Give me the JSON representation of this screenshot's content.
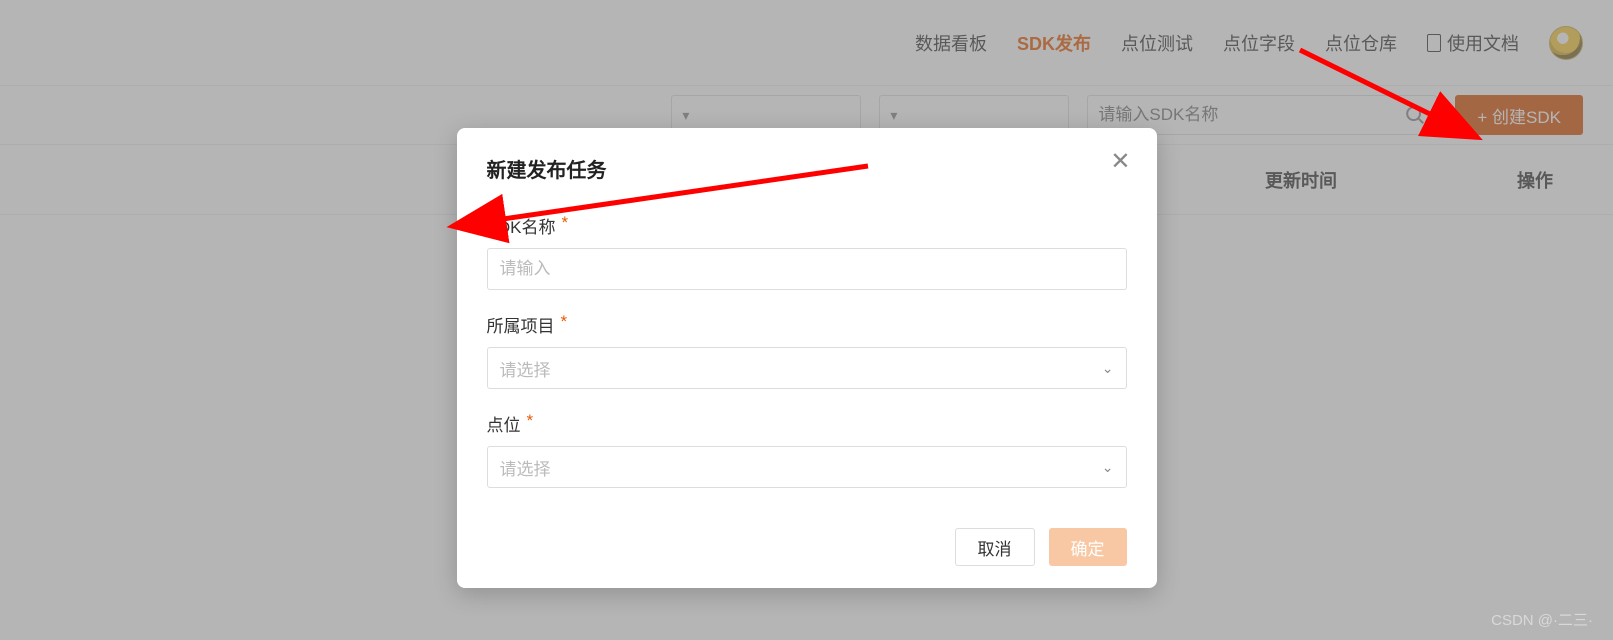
{
  "nav": {
    "items": [
      {
        "label": "数据看板",
        "active": false
      },
      {
        "label": "SDK发布",
        "active": true
      },
      {
        "label": "点位测试",
        "active": false
      },
      {
        "label": "点位字段",
        "active": false
      },
      {
        "label": "点位仓库",
        "active": false
      }
    ],
    "docs_label": "使用文档"
  },
  "toolbar": {
    "search_placeholder": "请输入SDK名称",
    "create_label": "+ 创建SDK"
  },
  "table": {
    "header_update_time": "更新时间",
    "header_action": "操作"
  },
  "modal": {
    "title": "新建发布任务",
    "fields": {
      "sdk_name": {
        "label": "SDK名称",
        "placeholder": "请输入"
      },
      "project": {
        "label": "所属项目",
        "placeholder": "请选择"
      },
      "point": {
        "label": "点位",
        "placeholder": "请选择"
      }
    },
    "cancel_label": "取消",
    "confirm_label": "确定"
  },
  "watermark": "CSDN @·二三·"
}
